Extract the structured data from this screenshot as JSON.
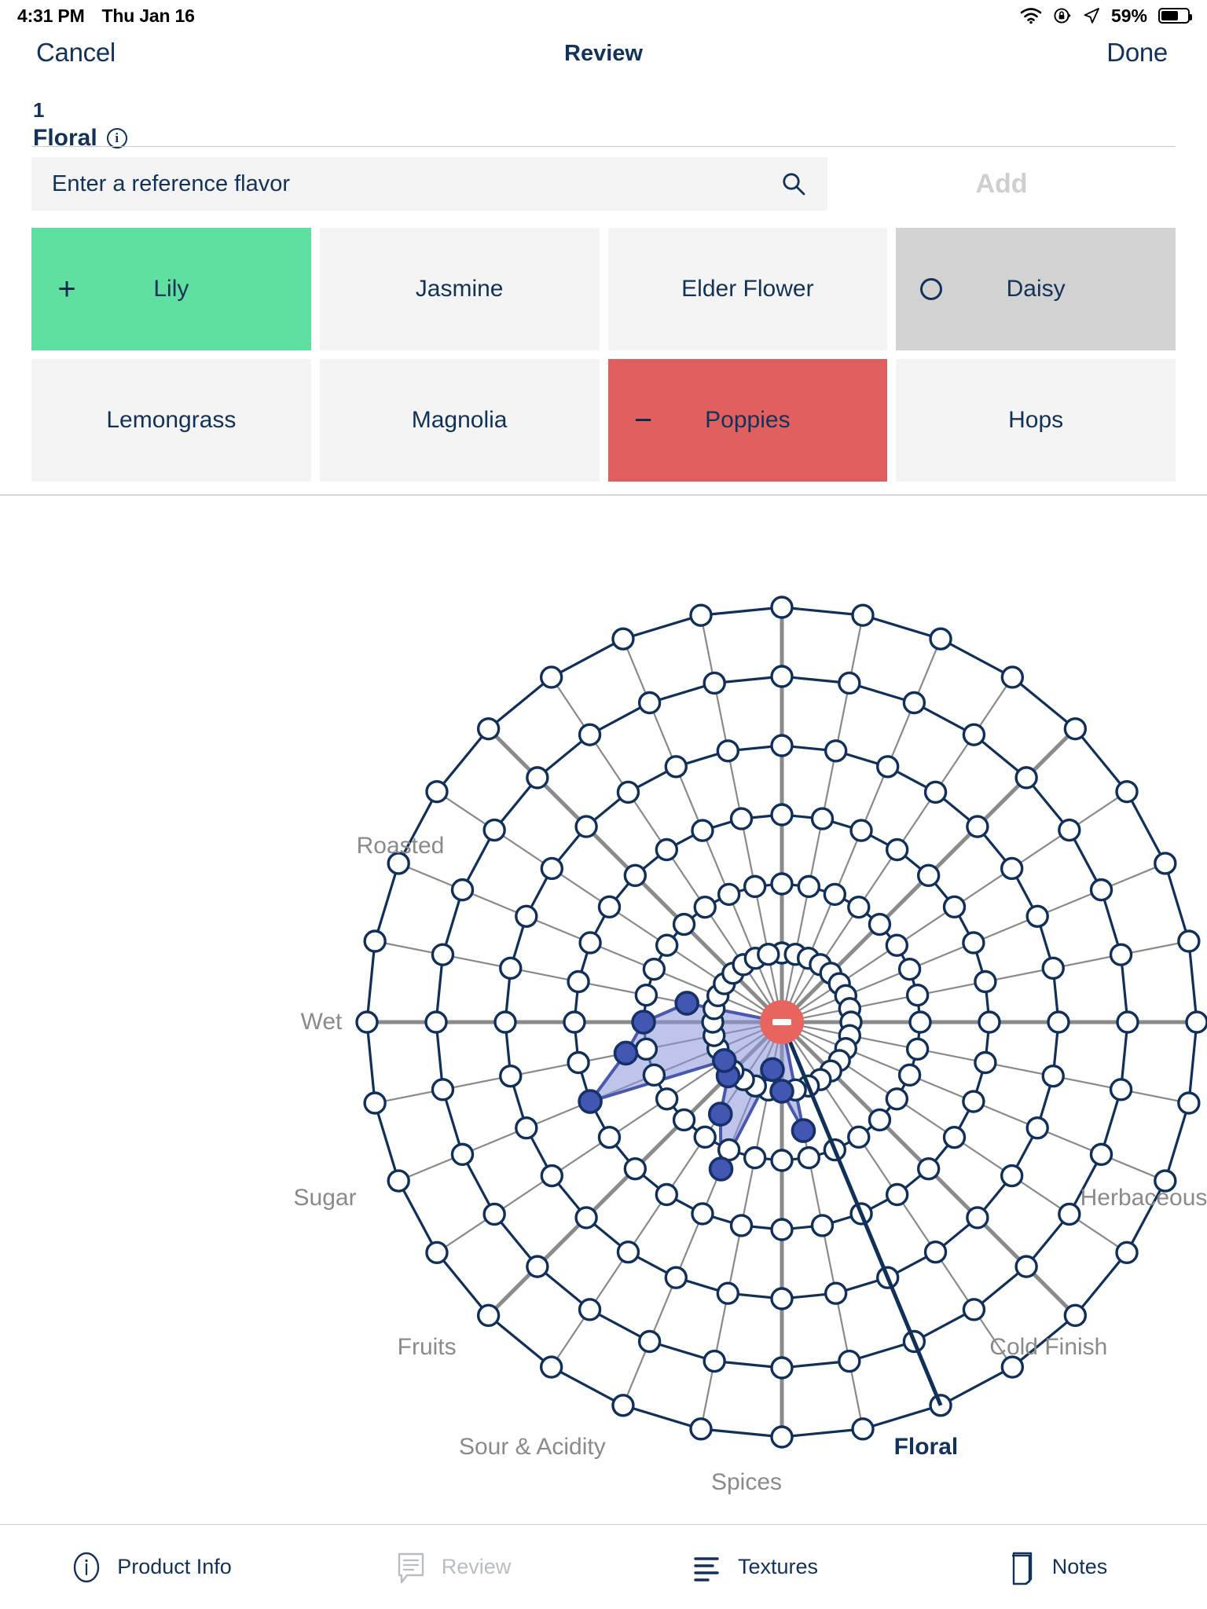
{
  "statusbar": {
    "time": "4:31 PM",
    "date": "Thu Jan 16",
    "battery_percent": "59%",
    "icons": [
      "wifi-icon",
      "rotation-lock-icon",
      "location-arrow-icon",
      "battery-icon"
    ]
  },
  "navbar": {
    "cancel_label": "Cancel",
    "title": "Review",
    "done_label": "Done"
  },
  "category": {
    "index": "1",
    "name": "Floral",
    "info_icon": "info-icon"
  },
  "search": {
    "placeholder": "Enter a reference flavor",
    "value": "",
    "icon": "search-icon",
    "add_label": "Add"
  },
  "tiles": [
    {
      "label": "Lily",
      "state": "positive",
      "mark": "plus"
    },
    {
      "label": "Jasmine",
      "state": "default",
      "mark": "none"
    },
    {
      "label": "Elder Flower",
      "state": "default",
      "mark": "none"
    },
    {
      "label": "Daisy",
      "state": "neutral",
      "mark": "circle"
    },
    {
      "label": "Lemongrass",
      "state": "default",
      "mark": "none"
    },
    {
      "label": "Magnolia",
      "state": "default",
      "mark": "none"
    },
    {
      "label": "Poppies",
      "state": "negative",
      "mark": "minus"
    },
    {
      "label": "Hops",
      "state": "default",
      "mark": "none"
    }
  ],
  "colors": {
    "navy": "#123259",
    "positive_green": "#5fdfa0",
    "negative_red": "#e06060",
    "neutral_gray": "#d2d2d2",
    "tile_default": "#f4f4f4",
    "accent_red": "#e8645f",
    "series_fill": "#8b95d9",
    "series_stroke": "#4b59ad",
    "label_gray": "#8a8a8a"
  },
  "chart_data": {
    "type": "radar",
    "title": "",
    "center_control": {
      "icon": "minus-icon",
      "color": "#e8645f"
    },
    "rings": 6,
    "selected_axis": "Floral",
    "axes": [
      {
        "label": "Wet",
        "angle_deg": 270,
        "value": 0,
        "selected": false,
        "label_pos": "center"
      },
      {
        "label": "Roasted",
        "angle_deg": 292.5,
        "value": 0,
        "selected": false,
        "label_pos": "right"
      },
      {
        "label": "Sugar",
        "angle_deg": 247.5,
        "value": 3,
        "selected": false,
        "label_pos": "left"
      },
      {
        "label": "Fruits",
        "angle_deg": 225,
        "value": 2,
        "selected": false,
        "label_pos": "left"
      },
      {
        "label": "Sour & Acidity",
        "angle_deg": 202.5,
        "value": 2,
        "selected": false,
        "label_pos": "left"
      },
      {
        "label": "Spices",
        "angle_deg": 180,
        "value": 0,
        "selected": false,
        "label_pos": "left"
      },
      {
        "label": "Floral",
        "angle_deg": 157.5,
        "value": 0,
        "selected": true,
        "label_pos": "left"
      },
      {
        "label": "Cold Finish",
        "angle_deg": 135,
        "value": 0,
        "selected": false,
        "label_pos": "left"
      },
      {
        "label": "Herbaceous",
        "angle_deg": 112.5,
        "value": 0,
        "selected": false,
        "label_pos": "left"
      }
    ],
    "series": [
      {
        "name": "Review",
        "fill": "#8b95d9",
        "stroke": "#4b59ad",
        "values_by_angle": [
          {
            "angle_deg": 247.5,
            "r": 3.0
          },
          {
            "angle_deg": 258.8,
            "r": 2.3
          },
          {
            "angle_deg": 270.0,
            "r": 2.0
          },
          {
            "angle_deg": 281.2,
            "r": 1.4
          },
          {
            "angle_deg": 202.5,
            "r": 2.3
          },
          {
            "angle_deg": 213.8,
            "r": 1.6
          },
          {
            "angle_deg": 225.0,
            "r": 1.1
          },
          {
            "angle_deg": 236.2,
            "r": 1.0
          },
          {
            "angle_deg": 168.8,
            "r": 1.6
          },
          {
            "angle_deg": 180.0,
            "r": 1.0
          },
          {
            "angle_deg": 191.2,
            "r": 0.7
          }
        ]
      }
    ],
    "grid": true,
    "legend": "none"
  },
  "tabbar": {
    "tabs": [
      {
        "label": "Product Info",
        "icon": "info-circle-icon",
        "active": true,
        "disabled": false
      },
      {
        "label": "Review",
        "icon": "comment-lines-icon",
        "active": false,
        "disabled": true
      },
      {
        "label": "Textures",
        "icon": "list-lines-icon",
        "active": false,
        "disabled": false
      },
      {
        "label": "Notes",
        "icon": "note-page-icon",
        "active": false,
        "disabled": false
      }
    ]
  }
}
